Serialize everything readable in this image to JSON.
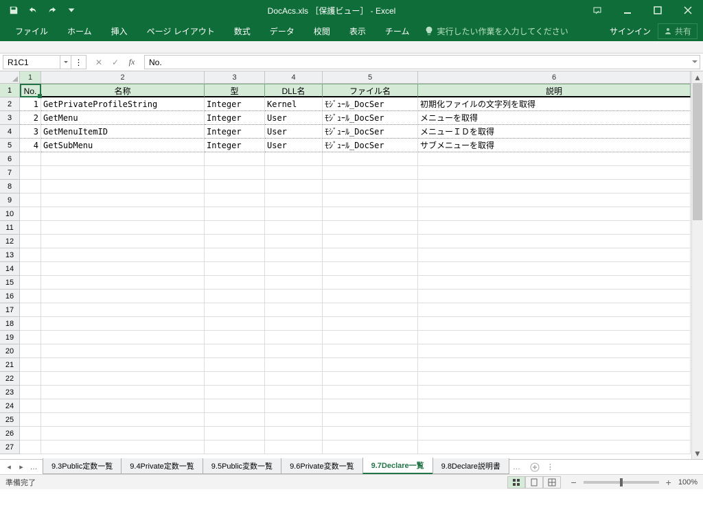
{
  "title": "DocAcs.xls ［保護ビュー］ - Excel",
  "qat": {
    "save": "保存",
    "undo": "元に戻す",
    "redo": "やり直し"
  },
  "ribbon_tabs": [
    "ファイル",
    "ホーム",
    "挿入",
    "ページ レイアウト",
    "数式",
    "データ",
    "校閲",
    "表示",
    "チーム"
  ],
  "tell_me": "実行したい作業を入力してください",
  "signin": "サインイン",
  "share": "共有",
  "name_box": "R1C1",
  "formula_value": "No.",
  "col_headers": [
    "1",
    "2",
    "3",
    "4",
    "5",
    "6"
  ],
  "table": {
    "headers": [
      "No.",
      "名称",
      "型",
      "DLL名",
      "ファイル名",
      "説明"
    ],
    "rows": [
      {
        "no": "1",
        "name": "GetPrivateProfileString",
        "type": "Integer",
        "dll": "Kernel",
        "file": "ﾓｼﾞｭｰﾙ_DocSer",
        "desc": "初期化ファイルの文字列を取得"
      },
      {
        "no": "2",
        "name": "GetMenu",
        "type": "Integer",
        "dll": "User",
        "file": "ﾓｼﾞｭｰﾙ_DocSer",
        "desc": "メニューを取得"
      },
      {
        "no": "3",
        "name": "GetMenuItemID",
        "type": "Integer",
        "dll": "User",
        "file": "ﾓｼﾞｭｰﾙ_DocSer",
        "desc": "メニューＩＤを取得"
      },
      {
        "no": "4",
        "name": "GetSubMenu",
        "type": "Integer",
        "dll": "User",
        "file": "ﾓｼﾞｭｰﾙ_DocSer",
        "desc": "サブメニューを取得"
      }
    ]
  },
  "sheet_tabs": [
    "9.3Public定数一覧",
    "9.4Private定数一覧",
    "9.5Public変数一覧",
    "9.6Private変数一覧",
    "9.7Declare一覧",
    "9.8Declare説明書"
  ],
  "active_sheet": 4,
  "status": "準備完了",
  "zoom": "100%"
}
